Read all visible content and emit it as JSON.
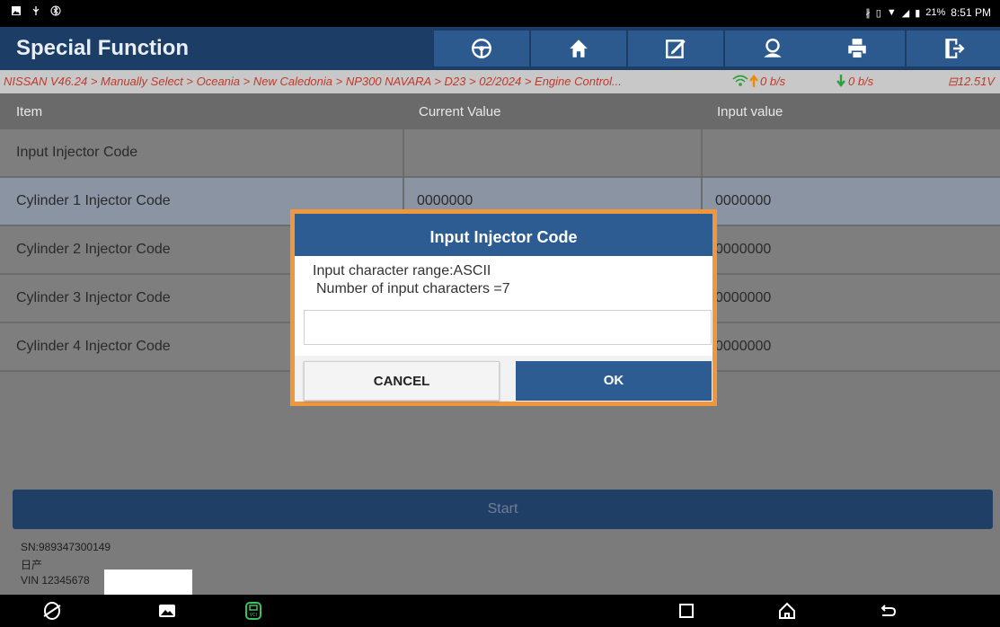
{
  "status_bar": {
    "time": "8:51 PM",
    "battery": "21%"
  },
  "header": {
    "title": "Special Function",
    "icons": [
      "steering-wheel-icon",
      "home-icon",
      "edit-report-icon",
      "user-icon",
      "print-icon",
      "exit-icon"
    ]
  },
  "breadcrumb": {
    "path": "NISSAN V46.24 > Manually Select > Oceania > New Caledonia > NP300 NAVARA > D23 > 02/2024 > Engine Control...",
    "upload": "0 b/s",
    "download": "0 b/s",
    "voltage": "12.51V"
  },
  "table": {
    "headers": [
      "Item",
      "Current Value",
      "Input value"
    ],
    "rows": [
      {
        "item": "Input Injector Code",
        "current": "",
        "input": ""
      },
      {
        "item": "Cylinder 1 Injector Code",
        "current": "0000000",
        "input": "0000000"
      },
      {
        "item": "Cylinder 2 Injector Code",
        "current": "",
        "input": "0000000"
      },
      {
        "item": "Cylinder 3 Injector Code",
        "current": "",
        "input": "0000000"
      },
      {
        "item": "Cylinder 4 Injector Code",
        "current": "",
        "input": "0000000"
      }
    ]
  },
  "start_button": "Start",
  "footer": {
    "sn": "SN:989347300149",
    "brand": "日产",
    "vin": "VIN 12345678"
  },
  "dialog": {
    "title": "Input Injector Code",
    "line1": "Input character range:ASCII",
    "line2": "Number of input characters =7",
    "input_value": "",
    "cancel": "CANCEL",
    "ok": "OK"
  },
  "colors": {
    "header_bg": "#1b3d66",
    "accent_blue": "#2d5c92",
    "dialog_border": "#f0963c",
    "breadcrumb_text": "#c0392b"
  }
}
